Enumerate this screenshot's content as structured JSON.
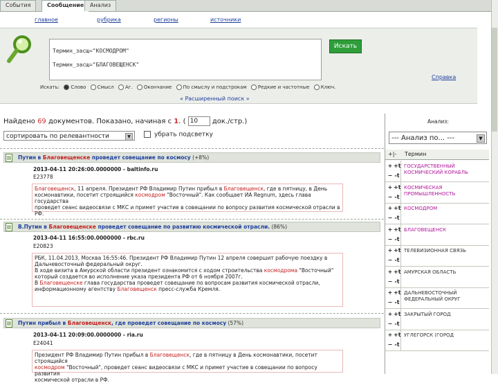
{
  "tabs": [
    "События",
    "Сообщение",
    "Анализ"
  ],
  "subnav": [
    "главное",
    "рубрика",
    "регионы",
    "источники"
  ],
  "search": {
    "query_lines": [
      "Термин_засщ=\"КОСМОДРОМ\"",
      "Термин_засщ=\"БЛАГОВЕЩЕНСК\""
    ],
    "button": "Искать",
    "help": "Справка",
    "options_label": "Искать:",
    "options": [
      "Слово",
      "Смысл",
      "Аг.",
      "Окончание",
      "По смыслу и подстрокам",
      "Редкие и частотные",
      "Ключ."
    ],
    "selected_option": 0,
    "advanced": "« Расширенный поиск »"
  },
  "results_header": {
    "found_prefix": "Найдено",
    "found_count": "69",
    "found_mid": "документов. Показано, начиная с",
    "start": "1",
    "per_page": "10",
    "per_page_suffix": "док./стр.)",
    "sort": "сортировать по релевантности",
    "no_highlight": "убрать подсветку"
  },
  "results": [
    {
      "title_a": "Путин в ",
      "title_red": "Благовещенске",
      "title_b": " проведет совещание по космосу",
      "pct": " (+8%)",
      "meta": "2013-04-11 20:26:00.0000000 - baltinfo.ru",
      "id": "E23778",
      "snippet": [
        [
          "",
          "Благовещенск",
          ", 11 апреля. Президент РФ Владимир Путин прибыл в ",
          "Благовещенск",
          ", где в пятницу, в День"
        ],
        [
          "космонавтики, посетит строящийся ",
          "космодром",
          " \"Восточный\". Как сообщает ИА Regnum, здесь глава государства",
          "",
          ""
        ],
        [
          "проведет сеанс видеосвязи с МКС и примет участие в совещании по вопросу развития космической отрасли в РФ.",
          "",
          "",
          "",
          ""
        ]
      ]
    },
    {
      "title_a": "В.Путин в ",
      "title_red": "Благовещенске",
      "title_b": " проведет совещание по развитию космической отрасли.",
      "pct": " (86%)",
      "meta": "2013-04-11 16:55:00.0000000 - rbc.ru",
      "id": "E20823",
      "snippet": [
        [
          "РБК, 11.04.2013, Москва 16:55:46. Президент РФ Владимир Путин 12 апреля совершит рабочую поездку в",
          "",
          "",
          "",
          ""
        ],
        [
          "Дальневосточный федеральный округ.",
          "",
          "",
          "",
          ""
        ],
        [
          "В ходе визита в Амурской области президент ознакомится с ходом строительства ",
          "космодрома",
          " \"Восточный\"",
          "",
          ""
        ],
        [
          "который создается во исполнение указа президента РФ от 6 ноября 2007г.",
          "",
          "",
          "",
          ""
        ],
        [
          "В ",
          "Благовещенске",
          " глава государства проведет совещание по вопросам развития космической отрасли,",
          "",
          ""
        ],
        [
          "информационному агентству ",
          "Благовещенск",
          " пресс-служба Кремля.",
          "",
          ""
        ]
      ]
    },
    {
      "title_a": "Путин прибыл в ",
      "title_red": "Благовещенск",
      "title_b": ", где проведет совещание по космосу",
      "pct": " (57%)",
      "meta": "2013-04-11 20:09:00.0000000 - ria.ru",
      "id": "E24041",
      "snippet": [
        [
          "Президент РФ Владимир Путин прибыл в ",
          "Благовещенск",
          ", где в пятницу в День космонавтики, посетит строящийся",
          "",
          ""
        ],
        [
          "",
          "космодром",
          " \"Восточный\", проведет сеанс видеосвязи с МКС и примет участие в совещании по вопросу развития",
          "",
          ""
        ],
        [
          "космической отрасли в РФ.",
          "",
          "",
          "",
          ""
        ]
      ]
    }
  ],
  "analysis": {
    "title": "Анализ:",
    "select": "--- Анализ по... ---",
    "col_head": "Термин",
    "terms": [
      {
        "label": "Государственный космический корабль",
        "color": "#b0179a"
      },
      {
        "label": "Космическая промышленность",
        "color": "#b0179a"
      },
      {
        "label": "Космодром",
        "color": "#b0179a"
      },
      {
        "label": "Благовещенск",
        "color": "#b0179a"
      },
      {
        "label": "Телевизионная связь",
        "color": "#333333"
      },
      {
        "label": "Амурская область",
        "color": "#333333"
      },
      {
        "label": "Дальневосточный федеральный округ",
        "color": "#333333"
      },
      {
        "label": "Закрытый город",
        "color": "#333333"
      },
      {
        "label": "Углегорск (город",
        "color": "#333333"
      }
    ]
  }
}
